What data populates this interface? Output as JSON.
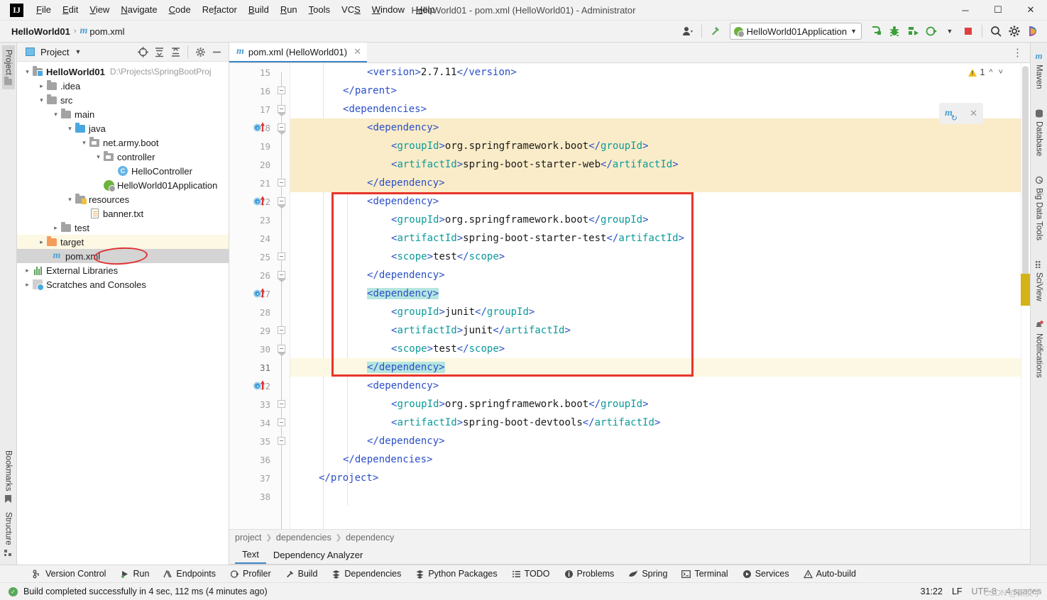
{
  "window": {
    "title": "HelloWorld01 - pom.xml (HelloWorld01) - Administrator",
    "logo": "IJ",
    "minimize": "─",
    "maximize": "☐",
    "close": "✕"
  },
  "menubar": {
    "items": [
      {
        "label": "File",
        "accel": "F"
      },
      {
        "label": "Edit",
        "accel": "E"
      },
      {
        "label": "View",
        "accel": "V"
      },
      {
        "label": "Navigate",
        "accel": "N"
      },
      {
        "label": "Code",
        "accel": "C"
      },
      {
        "label": "Refactor",
        "accel": "R"
      },
      {
        "label": "Build",
        "accel": "B"
      },
      {
        "label": "Run",
        "accel": "R"
      },
      {
        "label": "Tools",
        "accel": "T"
      },
      {
        "label": "VCS",
        "accel": "S"
      },
      {
        "label": "Window",
        "accel": "W"
      },
      {
        "label": "Help",
        "accel": "H"
      }
    ]
  },
  "navbar": {
    "breadcrumb": {
      "project": "HelloWorld01",
      "file": "pom.xml",
      "separator": "›"
    },
    "run_configuration": "HelloWorld01Application",
    "icons": [
      "user-avatar-icon",
      "hammer-build-icon",
      "run-icon",
      "debug-icon",
      "run-with-coverage-icon",
      "profiler-icon",
      "stop-icon",
      "search-everywhere-icon",
      "settings-gear-icon",
      "ide-assistant-icon"
    ]
  },
  "left_tool_strip": {
    "top": [
      {
        "label": "Project",
        "icon": "project-folder-icon",
        "active": true
      }
    ],
    "bottom": [
      {
        "label": "Bookmarks",
        "icon": "bookmark-icon",
        "active": false
      },
      {
        "label": "Structure",
        "icon": "structure-icon",
        "active": false
      }
    ]
  },
  "right_tool_strip": {
    "items": [
      {
        "label": "Maven",
        "icon": "maven-m-icon"
      },
      {
        "label": "Database",
        "icon": "database-icon"
      },
      {
        "label": "Big Data Tools",
        "icon": "big-data-tools-icon"
      },
      {
        "label": "SciView",
        "icon": "sciview-icon"
      },
      {
        "label": "Notifications",
        "icon": "notifications-bell-icon"
      }
    ]
  },
  "project_panel": {
    "title": "Project",
    "toolbar_icons": [
      "locate-icon",
      "expand-all-icon",
      "collapse-all-icon",
      "settings-gear-icon",
      "hide-icon"
    ],
    "tree": [
      {
        "depth": 0,
        "arrow": "⌄",
        "icon": "module-folder-icon",
        "label": "HelloWorld01",
        "bold": true,
        "path": "D:\\Projects\\SpringBootProj"
      },
      {
        "depth": 1,
        "arrow": "›",
        "icon": "folder-icon",
        "label": ".idea",
        "bold": false,
        "path": ""
      },
      {
        "depth": 1,
        "arrow": "⌄",
        "icon": "folder-icon",
        "label": "src",
        "bold": false,
        "path": ""
      },
      {
        "depth": 2,
        "arrow": "⌄",
        "icon": "folder-icon",
        "label": "main",
        "bold": false,
        "path": ""
      },
      {
        "depth": 3,
        "arrow": "⌄",
        "icon": "source-folder-icon",
        "label": "java",
        "bold": false,
        "path": ""
      },
      {
        "depth": 4,
        "arrow": "⌄",
        "icon": "package-icon",
        "label": "net.army.boot",
        "bold": false,
        "path": ""
      },
      {
        "depth": 5,
        "arrow": "⌄",
        "icon": "package-icon",
        "label": "controller",
        "bold": false,
        "path": ""
      },
      {
        "depth": 6,
        "arrow": "",
        "icon": "java-class-icon",
        "label": "HelloController",
        "bold": false,
        "path": ""
      },
      {
        "depth": 5,
        "arrow": "",
        "icon": "spring-boot-app-icon",
        "label": "HelloWorld01Application",
        "bold": false,
        "path": ""
      },
      {
        "depth": 3,
        "arrow": "⌄",
        "icon": "resources-folder-icon",
        "label": "resources",
        "bold": false,
        "path": ""
      },
      {
        "depth": 4,
        "arrow": "",
        "icon": "text-file-icon",
        "label": "banner.txt",
        "bold": false,
        "path": ""
      },
      {
        "depth": 2,
        "arrow": "›",
        "icon": "folder-icon",
        "label": "test",
        "bold": false,
        "path": ""
      },
      {
        "depth": 1,
        "arrow": "›",
        "icon": "target-folder-icon",
        "label": "target",
        "bold": false,
        "path": "",
        "highlight": "yellow"
      },
      {
        "depth": 1,
        "arrow": "",
        "icon": "maven-pom-icon",
        "label": "pom.xml",
        "bold": false,
        "path": "",
        "highlight": "selected",
        "annotation": "red-ellipse"
      },
      {
        "depth": 0,
        "arrow": "›",
        "icon": "external-libraries-icon",
        "label": "External Libraries",
        "bold": false,
        "path": ""
      },
      {
        "depth": 0,
        "arrow": "›",
        "icon": "scratches-icon",
        "label": "Scratches and Consoles",
        "bold": false,
        "path": ""
      }
    ]
  },
  "editor": {
    "tab": {
      "label": "pom.xml (HelloWorld01)",
      "icon": "maven-pom-icon",
      "close": "✕"
    },
    "inspection_widget": {
      "warning_count": "1",
      "up": "⌃",
      "down": "⌄"
    },
    "maven_popup": {
      "icon": "maven-reload-icon",
      "close": "✕"
    },
    "first_line_number": 15,
    "lines": [
      {
        "n": 15,
        "indent": 8,
        "tokens": [
          {
            "t": "<",
            "c": "tag"
          },
          {
            "t": "version",
            "c": "tagname"
          },
          {
            "t": ">",
            "c": "tag"
          },
          {
            "t": "2.7.11",
            "c": "txt"
          },
          {
            "t": "</",
            "c": "tag"
          },
          {
            "t": "version",
            "c": "tagname"
          },
          {
            "t": ">",
            "c": "tag"
          }
        ],
        "hl": "",
        "fold": "",
        "gutter": ""
      },
      {
        "n": 16,
        "indent": 4,
        "tokens": [
          {
            "t": "</",
            "c": "tag"
          },
          {
            "t": "parent",
            "c": "tagname"
          },
          {
            "t": ">",
            "c": "tag"
          }
        ],
        "hl": "",
        "fold": "close",
        "gutter": ""
      },
      {
        "n": 17,
        "indent": 4,
        "tokens": [
          {
            "t": "<",
            "c": "tag"
          },
          {
            "t": "dependencies",
            "c": "tagname"
          },
          {
            "t": ">",
            "c": "tag"
          }
        ],
        "hl": "",
        "fold": "open",
        "gutter": ""
      },
      {
        "n": 18,
        "indent": 8,
        "tokens": [
          {
            "t": "<",
            "c": "tag"
          },
          {
            "t": "dependency",
            "c": "tagname"
          },
          {
            "t": ">",
            "c": "tag"
          }
        ],
        "hl": "yellow",
        "fold": "open",
        "gutter": "dep"
      },
      {
        "n": 19,
        "indent": 12,
        "tokens": [
          {
            "t": "<",
            "c": "tag"
          },
          {
            "t": "groupId",
            "c": "attr"
          },
          {
            "t": ">",
            "c": "tag"
          },
          {
            "t": "org.springframework.boot",
            "c": "txt"
          },
          {
            "t": "</",
            "c": "tag"
          },
          {
            "t": "groupId",
            "c": "attr"
          },
          {
            "t": ">",
            "c": "tag"
          }
        ],
        "hl": "yellow",
        "fold": "",
        "gutter": ""
      },
      {
        "n": 20,
        "indent": 12,
        "tokens": [
          {
            "t": "<",
            "c": "tag"
          },
          {
            "t": "artifactId",
            "c": "attr"
          },
          {
            "t": ">",
            "c": "tag"
          },
          {
            "t": "spring-boot-starter-web",
            "c": "txt"
          },
          {
            "t": "</",
            "c": "tag"
          },
          {
            "t": "artifactId",
            "c": "attr"
          },
          {
            "t": ">",
            "c": "tag"
          }
        ],
        "hl": "yellow",
        "fold": "",
        "gutter": ""
      },
      {
        "n": 21,
        "indent": 8,
        "tokens": [
          {
            "t": "</",
            "c": "tag"
          },
          {
            "t": "dependency",
            "c": "tagname"
          },
          {
            "t": ">",
            "c": "tag"
          }
        ],
        "hl": "yellow",
        "fold": "close",
        "gutter": ""
      },
      {
        "n": 22,
        "indent": 8,
        "tokens": [
          {
            "t": "<",
            "c": "tag"
          },
          {
            "t": "dependency",
            "c": "tagname"
          },
          {
            "t": ">",
            "c": "tag"
          }
        ],
        "hl": "",
        "fold": "open",
        "gutter": "dep"
      },
      {
        "n": 23,
        "indent": 12,
        "tokens": [
          {
            "t": "<",
            "c": "tag"
          },
          {
            "t": "groupId",
            "c": "attr"
          },
          {
            "t": ">",
            "c": "tag"
          },
          {
            "t": "org.springframework.boot",
            "c": "txt"
          },
          {
            "t": "</",
            "c": "tag"
          },
          {
            "t": "groupId",
            "c": "attr"
          },
          {
            "t": ">",
            "c": "tag"
          }
        ],
        "hl": "",
        "fold": "",
        "gutter": ""
      },
      {
        "n": 24,
        "indent": 12,
        "tokens": [
          {
            "t": "<",
            "c": "tag"
          },
          {
            "t": "artifactId",
            "c": "attr"
          },
          {
            "t": ">",
            "c": "tag"
          },
          {
            "t": "spring-boot-starter-test",
            "c": "txt"
          },
          {
            "t": "</",
            "c": "tag"
          },
          {
            "t": "artifactId",
            "c": "attr"
          },
          {
            "t": ">",
            "c": "tag"
          }
        ],
        "hl": "",
        "fold": "",
        "gutter": ""
      },
      {
        "n": 25,
        "indent": 12,
        "tokens": [
          {
            "t": "<",
            "c": "tag"
          },
          {
            "t": "scope",
            "c": "attr"
          },
          {
            "t": ">",
            "c": "tag"
          },
          {
            "t": "test",
            "c": "txt"
          },
          {
            "t": "</",
            "c": "tag"
          },
          {
            "t": "scope",
            "c": "attr"
          },
          {
            "t": ">",
            "c": "tag"
          }
        ],
        "hl": "",
        "fold": "",
        "gutter": ""
      },
      {
        "n": 26,
        "indent": 8,
        "tokens": [
          {
            "t": "</",
            "c": "tag"
          },
          {
            "t": "dependency",
            "c": "tagname"
          },
          {
            "t": ">",
            "c": "tag"
          }
        ],
        "hl": "",
        "fold": "close",
        "gutter": ""
      },
      {
        "n": 27,
        "indent": 8,
        "tokens": [
          {
            "t": "<dependency>",
            "c": "tagname",
            "sel": true
          }
        ],
        "hl": "",
        "fold": "open",
        "gutter": "dep"
      },
      {
        "n": 28,
        "indent": 12,
        "tokens": [
          {
            "t": "<",
            "c": "tag"
          },
          {
            "t": "groupId",
            "c": "attr"
          },
          {
            "t": ">",
            "c": "tag"
          },
          {
            "t": "junit",
            "c": "txt"
          },
          {
            "t": "</",
            "c": "tag"
          },
          {
            "t": "groupId",
            "c": "attr"
          },
          {
            "t": ">",
            "c": "tag"
          }
        ],
        "hl": "",
        "fold": "",
        "gutter": ""
      },
      {
        "n": 29,
        "indent": 12,
        "tokens": [
          {
            "t": "<",
            "c": "tag"
          },
          {
            "t": "artifactId",
            "c": "attr"
          },
          {
            "t": ">",
            "c": "tag"
          },
          {
            "t": "junit",
            "c": "txt"
          },
          {
            "t": "</",
            "c": "tag"
          },
          {
            "t": "artifactId",
            "c": "attr"
          },
          {
            "t": ">",
            "c": "tag"
          }
        ],
        "hl": "",
        "fold": "",
        "gutter": ""
      },
      {
        "n": 30,
        "indent": 12,
        "tokens": [
          {
            "t": "<",
            "c": "tag"
          },
          {
            "t": "scope",
            "c": "attr"
          },
          {
            "t": ">",
            "c": "tag"
          },
          {
            "t": "test",
            "c": "txt"
          },
          {
            "t": "</",
            "c": "tag"
          },
          {
            "t": "scope",
            "c": "attr"
          },
          {
            "t": ">",
            "c": "tag"
          }
        ],
        "hl": "",
        "fold": "",
        "gutter": ""
      },
      {
        "n": 31,
        "indent": 8,
        "tokens": [
          {
            "t": "</dependency>",
            "c": "tagname",
            "sel": true
          }
        ],
        "hl": "cur",
        "fold": "close",
        "gutter": ""
      },
      {
        "n": 32,
        "indent": 8,
        "tokens": [
          {
            "t": "<",
            "c": "tag"
          },
          {
            "t": "dependency",
            "c": "tagname"
          },
          {
            "t": ">",
            "c": "tag"
          }
        ],
        "hl": "",
        "fold": "open",
        "gutter": "dep"
      },
      {
        "n": 33,
        "indent": 12,
        "tokens": [
          {
            "t": "<",
            "c": "tag"
          },
          {
            "t": "groupId",
            "c": "attr"
          },
          {
            "t": ">",
            "c": "tag"
          },
          {
            "t": "org.springframework.boot",
            "c": "txt"
          },
          {
            "t": "</",
            "c": "tag"
          },
          {
            "t": "groupId",
            "c": "attr"
          },
          {
            "t": ">",
            "c": "tag"
          }
        ],
        "hl": "",
        "fold": "",
        "gutter": ""
      },
      {
        "n": 34,
        "indent": 12,
        "tokens": [
          {
            "t": "<",
            "c": "tag"
          },
          {
            "t": "artifactId",
            "c": "attr"
          },
          {
            "t": ">",
            "c": "tag"
          },
          {
            "t": "spring-boot-devtools",
            "c": "txt"
          },
          {
            "t": "</",
            "c": "tag"
          },
          {
            "t": "artifactId",
            "c": "attr"
          },
          {
            "t": ">",
            "c": "tag"
          }
        ],
        "hl": "",
        "fold": "",
        "gutter": ""
      },
      {
        "n": 35,
        "indent": 8,
        "tokens": [
          {
            "t": "</",
            "c": "tag"
          },
          {
            "t": "dependency",
            "c": "tagname"
          },
          {
            "t": ">",
            "c": "tag"
          }
        ],
        "hl": "",
        "fold": "close",
        "gutter": ""
      },
      {
        "n": 36,
        "indent": 4,
        "tokens": [
          {
            "t": "</",
            "c": "tag"
          },
          {
            "t": "dependencies",
            "c": "tagname"
          },
          {
            "t": ">",
            "c": "tag"
          }
        ],
        "hl": "",
        "fold": "close",
        "gutter": ""
      },
      {
        "n": 37,
        "indent": 0,
        "tokens": [
          {
            "t": "</",
            "c": "tag"
          },
          {
            "t": "project",
            "c": "tagname"
          },
          {
            "t": ">",
            "c": "tag"
          }
        ],
        "hl": "",
        "fold": "close",
        "gutter": ""
      },
      {
        "n": 38,
        "indent": 0,
        "tokens": [],
        "hl": "",
        "fold": "",
        "gutter": ""
      }
    ],
    "breadcrumbs": [
      "project",
      "dependencies",
      "dependency"
    ],
    "bottom_tabs": [
      {
        "label": "Text",
        "active": true
      },
      {
        "label": "Dependency Analyzer",
        "active": false
      }
    ]
  },
  "tool_window_bar": {
    "items": [
      {
        "label": "Version Control",
        "icon": "branch-icon"
      },
      {
        "label": "Run",
        "icon": "run-play-icon"
      },
      {
        "label": "Endpoints",
        "icon": "endpoints-icon"
      },
      {
        "label": "Profiler",
        "icon": "profiler-icon"
      },
      {
        "label": "Build",
        "icon": "hammer-icon"
      },
      {
        "label": "Dependencies",
        "icon": "dependencies-icon"
      },
      {
        "label": "Python Packages",
        "icon": "packages-icon"
      },
      {
        "label": "TODO",
        "icon": "todo-list-icon"
      },
      {
        "label": "Problems",
        "icon": "problems-info-icon"
      },
      {
        "label": "Spring",
        "icon": "spring-leaf-icon"
      },
      {
        "label": "Terminal",
        "icon": "terminal-icon"
      },
      {
        "label": "Services",
        "icon": "services-icon"
      },
      {
        "label": "Auto-build",
        "icon": "warning-triangle-icon"
      }
    ]
  },
  "statusbar": {
    "message": "Build completed successfully in 4 sec, 112 ms (4 minutes ago)",
    "caret_position": "31:22",
    "line_separator": "LF",
    "encoding": "UTF-8",
    "indent": "4 spaces",
    "watermark": "CSDN @架反学"
  },
  "colors": {
    "accent_blue": "#3e86c9",
    "tag_blue": "#2a4fc9",
    "attr_teal": "#0a9a9a",
    "highlight_yellow": "#faecc8",
    "selection_cyan": "#b5e6e0",
    "annotation_red": "#e8352a",
    "warning_yellow": "#f0c020",
    "spring_green": "#6db33f"
  }
}
